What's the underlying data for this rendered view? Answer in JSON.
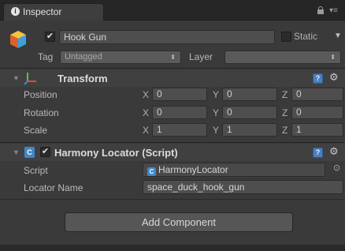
{
  "tab": {
    "label": "Inspector",
    "icon": "info-icon"
  },
  "object": {
    "name": "Hook Gun",
    "active_checked": true,
    "static_label": "Static",
    "static_checked": false,
    "tag_label": "Tag",
    "tag_value": "Untagged",
    "layer_label": "Layer",
    "layer_value": ""
  },
  "transform": {
    "title": "Transform",
    "rows": [
      {
        "label": "Position",
        "x": "0",
        "y": "0",
        "z": "0"
      },
      {
        "label": "Rotation",
        "x": "0",
        "y": "0",
        "z": "0"
      },
      {
        "label": "Scale",
        "x": "1",
        "y": "1",
        "z": "1"
      }
    ],
    "axis_labels": {
      "x": "X",
      "y": "Y",
      "z": "Z"
    }
  },
  "component": {
    "title": "Harmony Locator (Script)",
    "enabled": true,
    "script_label": "Script",
    "script_value": "HarmonyLocator",
    "locator_label": "Locator Name",
    "locator_value": "space_duck_hook_gun"
  },
  "add_component_label": "Add Component",
  "colors": {
    "background": "#3a3a3a",
    "accent": "#4a7fc1"
  }
}
